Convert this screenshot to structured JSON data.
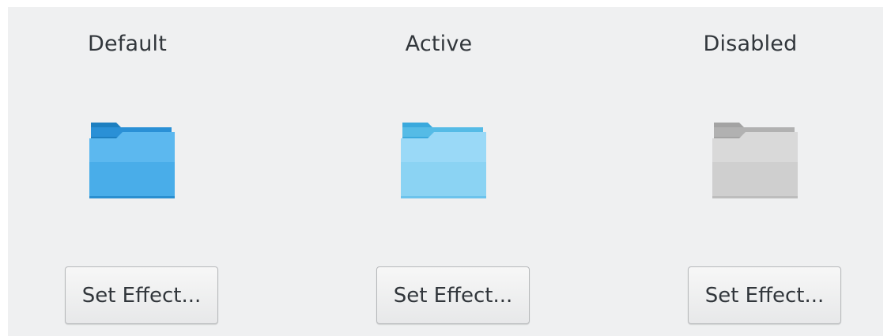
{
  "columns": [
    {
      "label": "Default",
      "icon": "folder-icon",
      "button_label": "Set Effect...",
      "colors": {
        "tab": "#1d7fc0",
        "back": "#2a90d6",
        "front_top": "#5cb8ef",
        "front_bottom": "#3aa4e4"
      }
    },
    {
      "label": "Active",
      "icon": "folder-icon",
      "button_label": "Set Effect...",
      "colors": {
        "tab": "#3aa9dd",
        "back": "#55bbe6",
        "front_top": "#9ad9f7",
        "front_bottom": "#7fcdf1"
      }
    },
    {
      "label": "Disabled",
      "icon": "folder-icon",
      "button_label": "Set Effect...",
      "colors": {
        "tab": "#a3a3a3",
        "back": "#b1b1b1",
        "front_top": "#d9d9d9",
        "front_bottom": "#c7c7c7"
      }
    }
  ]
}
